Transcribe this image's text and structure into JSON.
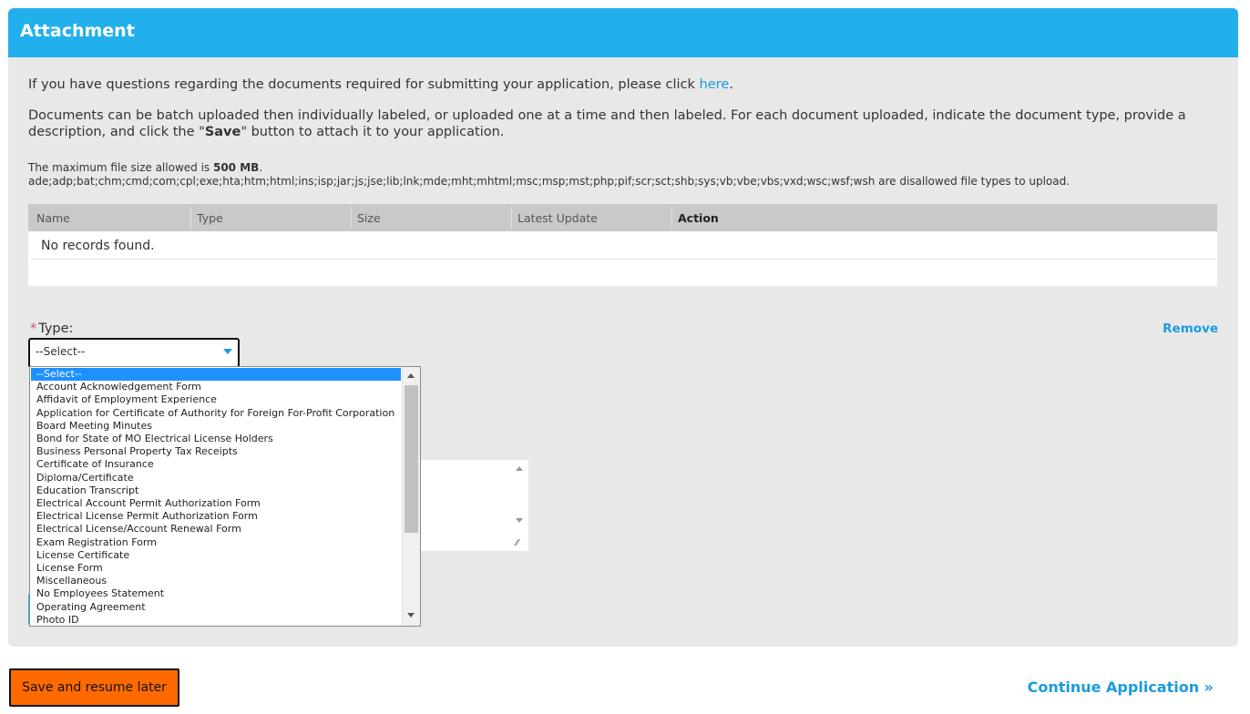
{
  "panel": {
    "title": "Attachment",
    "questions_text": "If you have questions regarding the documents required for submitting your application, please click ",
    "questions_link": "here",
    "questions_end": ".",
    "batch_text_1": "Documents can be batch uploaded then individually labeled, or uploaded one at a time and then labeled. For each document uploaded, indicate the document type, provide a description, and click the \"",
    "batch_save": "Save",
    "batch_text_2": "\" button to attach it to your application.",
    "max_size_prefix": "The maximum file size allowed is ",
    "max_size_value": "500 MB",
    "max_size_suffix": ".",
    "disallowed_types": "ade;adp;bat;chm;cmd;com;cpl;exe;hta;htm;html;ins;isp;jar;js;jse;lib;lnk;mde;mht;mhtml;msc;msp;mst;php;pif;scr;sct;shb;sys;vb;vbe;vbs;vxd;wsc;wsf;wsh",
    "disallowed_suffix": " are disallowed file types to upload."
  },
  "table": {
    "columns": [
      "Name",
      "Type",
      "Size",
      "Latest Update",
      "Action"
    ],
    "empty_text": "No records found."
  },
  "form": {
    "type_required_mark": "*",
    "type_label": "Type:",
    "remove_label": "Remove",
    "type_selected": "--Select--",
    "type_options": [
      "--Select--",
      "Account Acknowledgement Form",
      "Affidavit of Employment Experience",
      "Application for Certificate of Authority for Foreign For-Profit Corporation",
      "Board Meeting Minutes",
      "Bond for State of MO Electrical License Holders",
      "Business Personal Property Tax Receipts",
      "Certificate of Insurance",
      "Diploma/Certificate",
      "Education Transcript",
      "Electrical Account Permit Authorization Form",
      "Electrical License Permit Authorization Form",
      "Electrical License/Account Renewal Form",
      "Exam Registration Form",
      "License Certificate",
      "License Form",
      "Miscellaneous",
      "No Employees Statement",
      "Operating Agreement",
      "Photo ID"
    ]
  },
  "footer": {
    "save_label": "Save and resume later",
    "continue_label": "Continue Application »"
  }
}
